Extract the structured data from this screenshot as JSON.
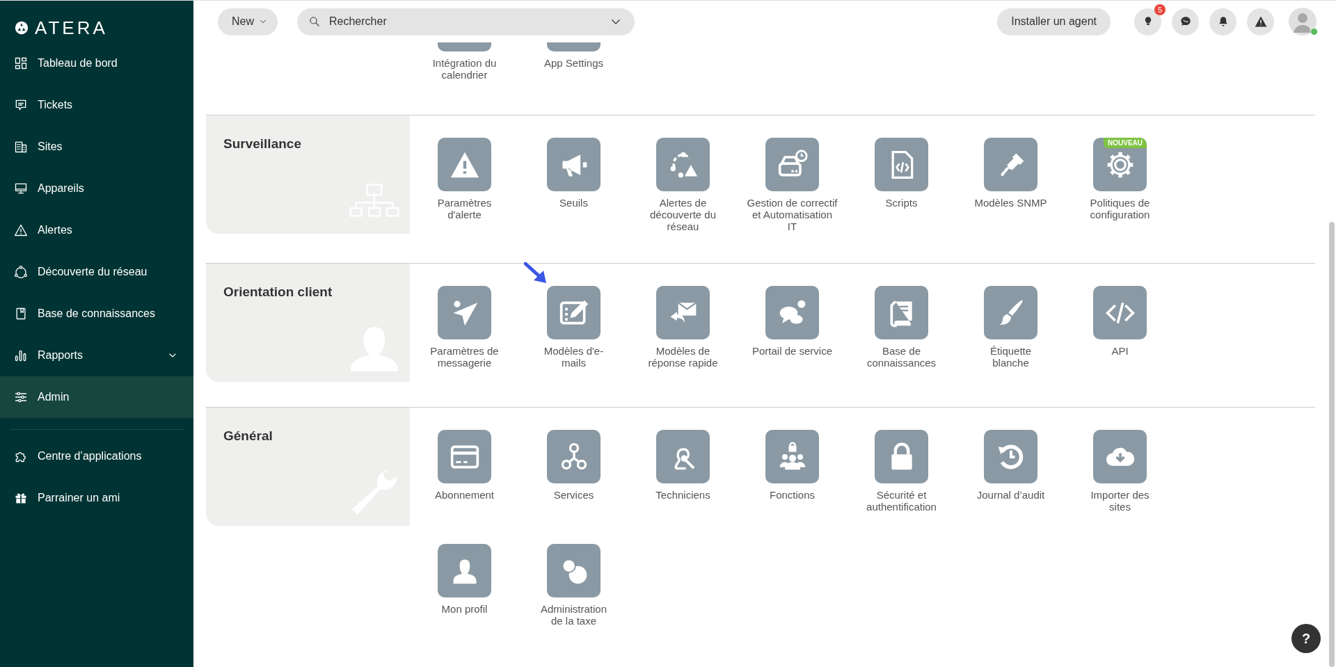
{
  "sidebar": {
    "logo": "ATERA",
    "items": [
      {
        "label": "Tableau de bord",
        "kind": "link",
        "selected": false
      },
      {
        "label": "Tickets",
        "kind": "link",
        "selected": false
      },
      {
        "label": "Sites",
        "kind": "link",
        "selected": false
      },
      {
        "label": "Appareils",
        "kind": "link",
        "selected": false
      },
      {
        "label": "Alertes",
        "kind": "link",
        "selected": false
      },
      {
        "label": "Découverte du réseau",
        "kind": "link",
        "selected": false
      },
      {
        "label": "Base de connaissances",
        "kind": "link",
        "selected": false
      },
      {
        "label": "Rapports",
        "kind": "group",
        "selected": false,
        "expanded": false
      },
      {
        "label": "Admin",
        "kind": "link",
        "selected": true
      }
    ],
    "bottom_items": [
      {
        "label": "Centre d’applications",
        "selected": false
      },
      {
        "label": "Parrainer un ami",
        "selected": false
      }
    ]
  },
  "topbar": {
    "new_button": "New",
    "search": {
      "placeholder": "Rechercher"
    },
    "install_button": "Installer un agent",
    "tips_badge": "5",
    "user_online": true
  },
  "partial_section": {
    "items": [
      {
        "label": "Intégration du\ncalendrier"
      },
      {
        "label": "App Settings"
      }
    ]
  },
  "sections": [
    {
      "title": "Surveillance",
      "items": [
        {
          "label": "Paramètres\nd'alerte"
        },
        {
          "label": "Seuils"
        },
        {
          "label": "Alertes de\ndécouverte du\nréseau"
        },
        {
          "label": "Gestion de correctif\net Automatisation\nIT"
        },
        {
          "label": "Scripts"
        },
        {
          "label": "Modèles SNMP"
        },
        {
          "label": "Politiques de\nconfiguration",
          "badge": "NOUVEAU"
        }
      ]
    },
    {
      "title": "Orientation client",
      "items": [
        {
          "label": "Paramètres de\nmessagerie"
        },
        {
          "label": "Modèles d'e-\nmails"
        },
        {
          "label": "Modèles de\nréponse rapide"
        },
        {
          "label": "Portail de service"
        },
        {
          "label": "Base de\nconnaissances"
        },
        {
          "label": "Étiquette\nblanche"
        },
        {
          "label": "API"
        }
      ]
    },
    {
      "title": "Général",
      "items": [
        {
          "label": "Abonnement"
        },
        {
          "label": "Services"
        },
        {
          "label": "Techniciens"
        },
        {
          "label": "Fonctions"
        },
        {
          "label": "Sécurité et\nauthentification"
        },
        {
          "label": "Journal d’audit"
        },
        {
          "label": "Importer des\nsites"
        },
        {
          "label": "Mon profil"
        },
        {
          "label": "Administration\nde la taxe"
        }
      ]
    }
  ],
  "help_button": "?"
}
